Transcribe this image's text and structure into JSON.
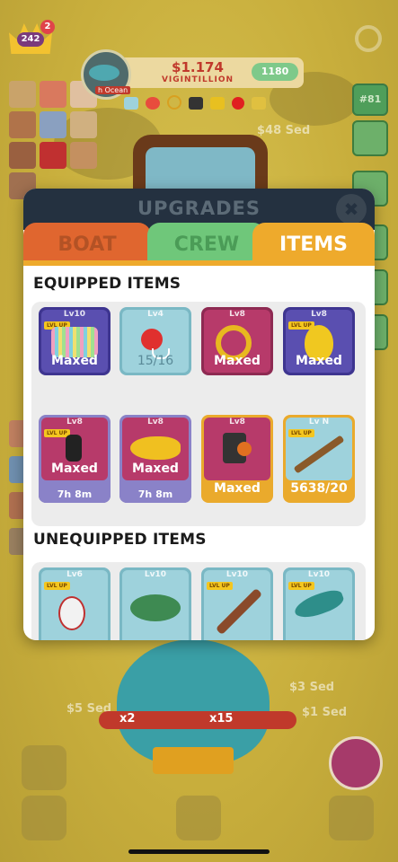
{
  "hud": {
    "crown_level": "242",
    "notifications": "2",
    "money_value": "$1.174",
    "money_unit": "VIGINTILLION",
    "gem_count": "1180",
    "fish_label": "h Ocean",
    "level_badge": "#81"
  },
  "background_prices": {
    "top_right": "$48 Sed",
    "bottom_left": "$5 Sed",
    "bottom_right_1": "$3 Sed",
    "bottom_right_2": "$1 Sed"
  },
  "multipliers": {
    "left": "x2",
    "right": "x15"
  },
  "modal": {
    "title": "UPGRADES",
    "close_label": "✖",
    "tabs": [
      {
        "label": "BOAT"
      },
      {
        "label": "CREW"
      },
      {
        "label": "ITEMS"
      }
    ],
    "equipped_title": "EQUIPPED ITEMS",
    "unequipped_title": "UNEQUIPPED ITEMS",
    "lvl_up_label": "LVL UP",
    "equipped": [
      {
        "level": "Lv10",
        "label": "Maxed",
        "color": "#5a4fb0",
        "icon": "fishing-line-spool-icon",
        "lvl_up": true
      },
      {
        "level": "Lv4",
        "label": "15/16",
        "color": "#9ed2dc",
        "icon": "bobber-icon",
        "lvl_up": false
      },
      {
        "level": "Lv8",
        "label": "Maxed",
        "color": "#b73a6a",
        "icon": "reel-icon",
        "lvl_up": false
      },
      {
        "level": "Lv8",
        "label": "Maxed",
        "color": "#5a4fb0",
        "icon": "golden-egg-icon",
        "lvl_up": true
      },
      {
        "level": "Lv8",
        "label": "Maxed",
        "sub": "7h 8m",
        "color": "#b73a6a",
        "icon": "fly-hook-icon",
        "lvl_up": true
      },
      {
        "level": "Lv8",
        "label": "Maxed",
        "sub": "7h 8m",
        "color": "#b73a6a",
        "icon": "yellow-lure-icon",
        "lvl_up": false
      },
      {
        "level": "Lv8",
        "label": "Maxed",
        "color": "#b73a6a",
        "icon": "rod-reel-icon",
        "lvl_up": false
      },
      {
        "level": "Lv N",
        "label": "5638/20",
        "color": "#9ed2dc",
        "icon": "wooden-rod-icon",
        "lvl_up": true
      }
    ],
    "unequipped": [
      {
        "level": "Lv6",
        "color": "#9ed2dc",
        "icon": "spinner-lure-icon",
        "lvl_up": true
      },
      {
        "level": "Lv10",
        "color": "#9ed2dc",
        "icon": "green-hat-icon",
        "lvl_up": false
      },
      {
        "level": "Lv10",
        "color": "#9ed2dc",
        "icon": "rod-handle-icon",
        "lvl_up": true
      },
      {
        "level": "Lv10",
        "color": "#9ed2dc",
        "icon": "teal-lure-icon",
        "lvl_up": true
      }
    ]
  }
}
